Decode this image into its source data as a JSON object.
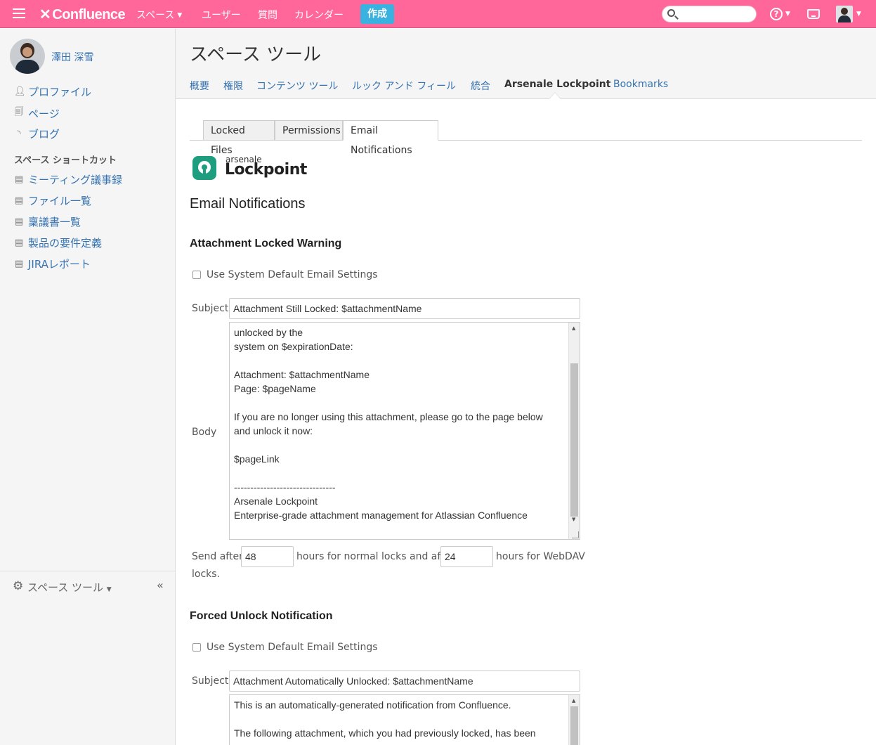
{
  "topnav": {
    "logo": "Confluence",
    "items": [
      {
        "label": "スペース",
        "caret": true
      },
      {
        "label": "ユーザー",
        "caret": false
      },
      {
        "label": "質問",
        "caret": false
      },
      {
        "label": "カレンダー",
        "caret": false
      }
    ],
    "create_label": "作成",
    "search_placeholder": "",
    "accent": "#ff6699"
  },
  "sidebar": {
    "user_name": "澤田 深雪",
    "links": [
      {
        "label": "プロファイル",
        "icon": "person-icon"
      },
      {
        "label": "ページ",
        "icon": "page-icon"
      },
      {
        "label": "ブログ",
        "icon": "rss-icon"
      }
    ],
    "section_title": "スペース ショートカット",
    "shortcuts": [
      {
        "label": "ミーティング議事録",
        "icon": "doc-icon"
      },
      {
        "label": "ファイル一覧",
        "icon": "files-icon"
      },
      {
        "label": "稟議書一覧",
        "icon": "doc-icon"
      },
      {
        "label": "製品の要件定義",
        "icon": "doc-icon"
      },
      {
        "label": "JIRAレポート",
        "icon": "jira-doc-icon"
      }
    ],
    "footer_label": "スペース ツール"
  },
  "header": {
    "title": "スペース ツール",
    "tabs": [
      {
        "label": "概要",
        "active": false
      },
      {
        "label": "権限",
        "active": false
      },
      {
        "label": "コンテンツ ツール",
        "active": false
      },
      {
        "label": "ルック アンド フィール",
        "active": false
      },
      {
        "label": "統合",
        "active": false
      },
      {
        "label": "Arsenale Lockpoint",
        "active": true
      },
      {
        "label": "Bookmarks",
        "active": false
      }
    ]
  },
  "main": {
    "subtabs": [
      {
        "label": "Locked Files",
        "active": false
      },
      {
        "label": "Permissions",
        "active": false
      },
      {
        "label": "Email Notifications",
        "active": true
      }
    ],
    "logo_small": "arsenale",
    "logo_big": "Lockpoint",
    "heading": "Email Notifications",
    "section1": {
      "title": "Attachment Locked Warning",
      "checkbox_label": "Use System Default Email Settings",
      "subject_label": "Subject",
      "subject_value": "Attachment Still Locked: $attachmentName",
      "body_label": "Body",
      "body_value": "unlocked by the\nsystem on $expirationDate:\n\nAttachment: $attachmentName\nPage: $pageName\n\nIf you are no longer using this attachment, please go to the page below\nand unlock it now:\n\n$pageLink\n\n-------------------------------\nArsenale Lockpoint\nEnterprise-grade attachment management for Atlassian Confluence",
      "send_after": "Send after",
      "normal_hours": "48",
      "mid_text": "hours for normal locks and after",
      "webdav_hours": "24",
      "end_text": "hours for WebDAV",
      "end_text2": "locks."
    },
    "section2": {
      "title": "Forced Unlock Notification",
      "checkbox_label": "Use System Default Email Settings",
      "subject_label": "Subject",
      "subject_value": "Attachment Automatically Unlocked: $attachmentName",
      "body_value": "This is an automatically-generated notification from Confluence.\n\nThe following attachment, which you had previously locked, has been"
    }
  }
}
